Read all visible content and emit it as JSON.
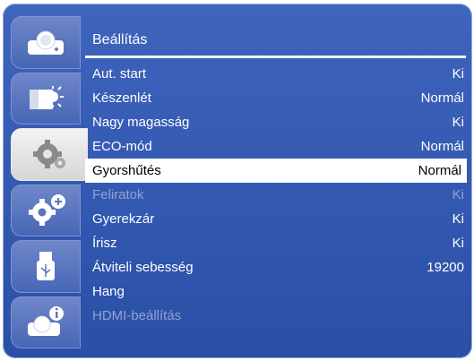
{
  "menu": {
    "title": "Beállítás",
    "items": [
      {
        "label": "Aut. start",
        "value": "Ki",
        "state": "normal"
      },
      {
        "label": "Készenlét",
        "value": "Normál",
        "state": "normal"
      },
      {
        "label": "Nagy magasság",
        "value": "Ki",
        "state": "normal"
      },
      {
        "label": "ECO-mód",
        "value": "Normál",
        "state": "normal"
      },
      {
        "label": "Gyorshűtés",
        "value": "Normál",
        "state": "selected"
      },
      {
        "label": "Feliratok",
        "value": "Ki",
        "state": "disabled"
      },
      {
        "label": "Gyerekzár",
        "value": "Ki",
        "state": "normal"
      },
      {
        "label": "Írisz",
        "value": "Ki",
        "state": "normal"
      },
      {
        "label": "Átviteli sebesség",
        "value": "19200",
        "state": "normal"
      },
      {
        "label": "Hang",
        "value": "",
        "state": "normal"
      },
      {
        "label": "HDMI-beállítás",
        "value": "",
        "state": "disabled"
      }
    ]
  },
  "sidebar": {
    "tabs": [
      {
        "icon": "projector-icon",
        "active": false
      },
      {
        "icon": "image-brightness-icon",
        "active": false
      },
      {
        "icon": "gear-settings-icon",
        "active": true
      },
      {
        "icon": "gear-advanced-icon",
        "active": false
      },
      {
        "icon": "usb-icon",
        "active": false
      },
      {
        "icon": "projector-info-icon",
        "active": false
      }
    ]
  },
  "colors": {
    "background": "#2f55ad",
    "selected_row": "#ffffff",
    "disabled_text": "#8fa3d3"
  }
}
